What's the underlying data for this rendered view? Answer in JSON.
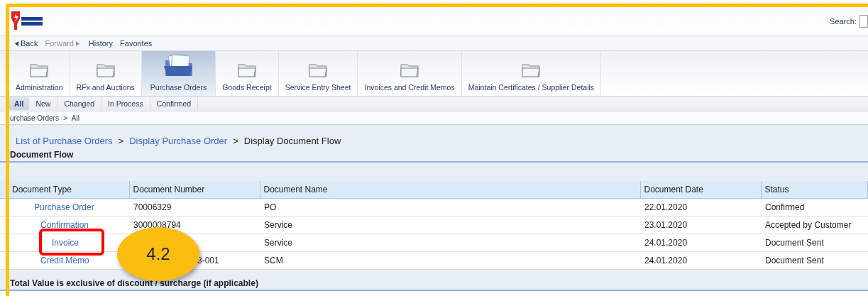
{
  "header": {
    "search_label": "Search:"
  },
  "nav": [
    {
      "label": "Back",
      "kind": "back",
      "disabled": false
    },
    {
      "label": "Forward",
      "kind": "forward",
      "disabled": true
    },
    {
      "label": "History",
      "kind": "plain",
      "disabled": false
    },
    {
      "label": "Favorites",
      "kind": "plain",
      "disabled": false
    }
  ],
  "tabs": [
    {
      "label": "Administration",
      "selected": false
    },
    {
      "label": "RFx and Auctions",
      "selected": false
    },
    {
      "label": "Purchase Orders",
      "selected": true
    },
    {
      "label": "Goods Receipt",
      "selected": false
    },
    {
      "label": "Service Entry Sheet",
      "selected": false
    },
    {
      "label": "Invoices and Credit Memos",
      "selected": false
    },
    {
      "label": "Maintain Certificates / Supplier Details",
      "selected": false
    }
  ],
  "subtabs": [
    {
      "label": "All",
      "selected": true
    },
    {
      "label": "New",
      "selected": false
    },
    {
      "label": "Changed",
      "selected": false
    },
    {
      "label": "In Process",
      "selected": false
    },
    {
      "label": "Confirmed",
      "selected": false
    }
  ],
  "path": [
    "urchase Orders",
    "All"
  ],
  "path_separator": ">",
  "breadcrumb": [
    {
      "label": "List of Purchase Orders",
      "link": true
    },
    {
      "label": "Display Purchase Order",
      "link": true
    },
    {
      "label": "Display Document Flow",
      "link": false
    }
  ],
  "breadcrumb_separator": ">",
  "section_title": "Document Flow",
  "table": {
    "columns": [
      "Document Type",
      "Document Number",
      "Document Name",
      "Document Date",
      "Status"
    ],
    "rows": [
      {
        "type": "Purchase Order",
        "number": "70006329",
        "name": "PO",
        "date": "22.01.2020",
        "status": "Confirmed",
        "highlighted": false,
        "children": [
          {
            "type": "Confirmation",
            "number": "3000008794",
            "name": "Service",
            "date": "23.01.2020",
            "status": "Accepted by Customer",
            "highlighted": false,
            "children": [
              {
                "type": "Invoice",
                "name": "Service",
                "date": "24.01.2020",
                "status": "Document Sent",
                "highlighted": true
              }
            ]
          },
          {
            "type": "Credit Memo",
            "number": "3-001",
            "number_covered": true,
            "name": "SCM",
            "date": "24.01.2020",
            "status": "Document Sent",
            "highlighted": false
          }
        ]
      }
    ]
  },
  "footer_note": "Total Value is exclusive of discount / surcharge (if applicable)",
  "callout": {
    "label": "4.2"
  }
}
